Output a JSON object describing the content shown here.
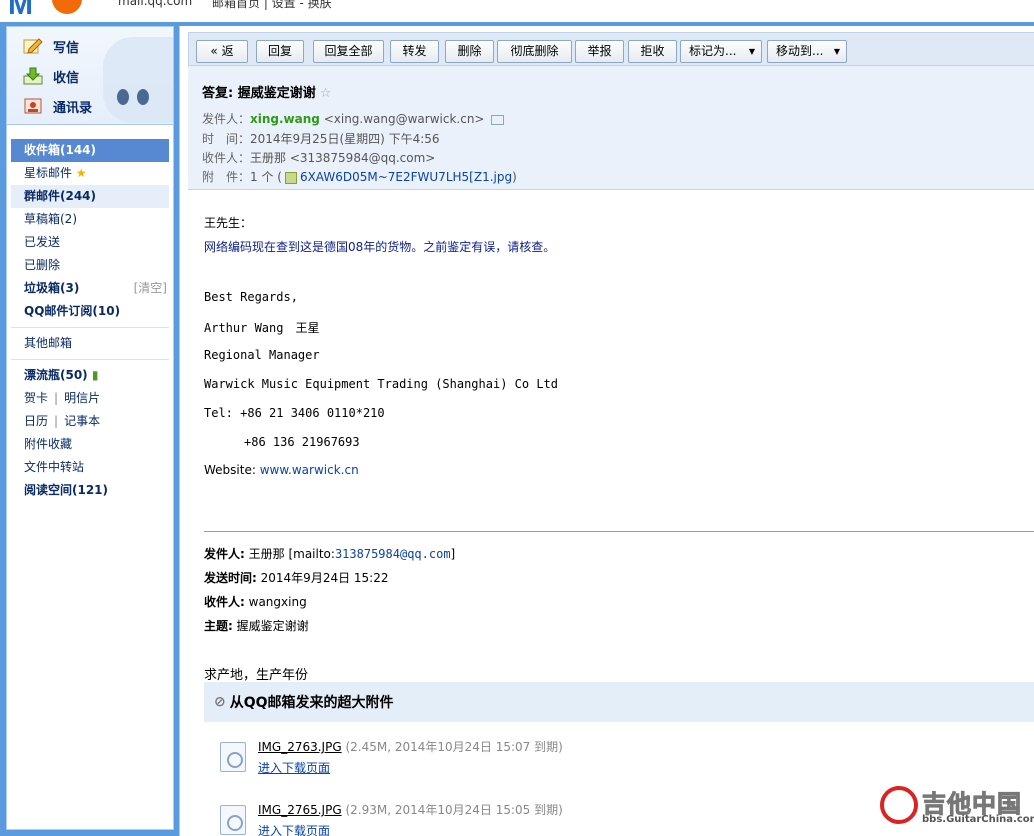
{
  "topbar": {
    "url": "mail.qq.com",
    "links": "邮箱首页 | 设置 - 换肤"
  },
  "quick": {
    "write": "写信",
    "receive": "收信",
    "contacts": "通讯录"
  },
  "folders": [
    {
      "label": "收件箱(144)"
    },
    {
      "label": "星标邮件"
    },
    {
      "label": "群邮件(244)"
    },
    {
      "label": "草稿箱(2)"
    },
    {
      "label": "已发送"
    },
    {
      "label": "已删除"
    },
    {
      "label": "垃圾箱(3)",
      "action": "[清空]"
    },
    {
      "label": "QQ邮件订阅(10)"
    },
    {
      "label": "其他邮箱"
    },
    {
      "label": "漂流瓶(50)"
    },
    {
      "label": "贺卡",
      "label2": "明信片"
    },
    {
      "label": "日历",
      "label2": "记事本"
    },
    {
      "label": "附件收藏"
    },
    {
      "label": "文件中转站"
    },
    {
      "label": "阅读空间(121)"
    }
  ],
  "toolbar": {
    "back": "« 返回",
    "reply": "回复",
    "reply_all": "回复全部",
    "forward": "转发",
    "delete": "删除",
    "perm_delete": "彻底删除",
    "report": "举报",
    "reject": "拒收",
    "mark": "标记为...",
    "move": "移动到..."
  },
  "mail": {
    "subject": "答复: 握威鉴定谢谢",
    "star": "☆",
    "from_label": "发件人：",
    "from_name": "xing.wang",
    "from_addr": "<xing.wang@warwick.cn>",
    "time_label": "时　间：",
    "time": "2014年9月25日(星期四) 下午4:56",
    "to_label": "收件人：",
    "to": "王册那 <313875984@qq.com>",
    "att_label": "附　件：",
    "att_count": "1 个 (",
    "att_name": "6XAW6D05M~7E2FWU7LH5[Z1.jpg",
    "att_close": ")"
  },
  "body": {
    "greeting": "王先生：",
    "line1": "网络编码现在查到这是德国08年的货物。之前鉴定有误，请核查。",
    "sig1": "Best Regards,",
    "sig2": "Arthur Wang　王星",
    "sig3": "Regional Manager",
    "sig4": "Warwick Music Equipment Trading (Shanghai) Co Ltd",
    "sig5": "Tel: +86 21 3406 0110*210",
    "sig6": "+86 136 21967693",
    "web_label": "Website: ",
    "web": "www.warwick.cn"
  },
  "quoted": {
    "from_label": "发件人:",
    "from_value": "王册那 [mailto:",
    "from_link": "313875984@qq.com",
    "from_close": "]",
    "sent_label": "发送时间:",
    "sent_value": "2014年9月24日 15:22",
    "to_label": "收件人:",
    "to_value": "wangxing",
    "subj_label": "主题:",
    "subj_value": "握威鉴定谢谢",
    "text": "求产地，生产年份"
  },
  "bigattach": {
    "title": "从QQ邮箱发来的超大附件",
    "files": [
      {
        "name": "IMG_2763.JPG",
        "info": "(2.45M, 2014年10月24日 15:07 到期)",
        "link": "进入下载页面"
      },
      {
        "name": "IMG_2765.JPG",
        "info": "(2.93M, 2014年10月24日 15:05 到期)",
        "link": "进入下载页面"
      }
    ]
  },
  "watermark": {
    "text": "吉他中国",
    "sub": "bbs.GuitarChina.com"
  }
}
